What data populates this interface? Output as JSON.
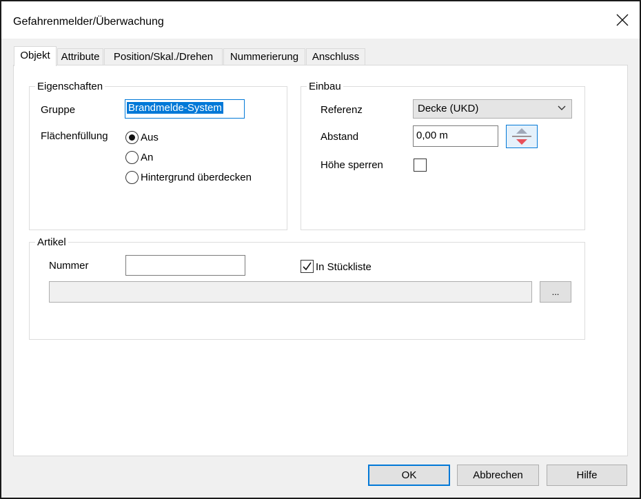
{
  "window": {
    "title": "Gefahrenmelder/Überwachung"
  },
  "icons": {
    "close": "close-icon",
    "height_toggle": "height-arrows-icon",
    "dropdown": "chevron-down-icon",
    "check": "checkmark-icon"
  },
  "tabs": [
    {
      "label": "Objekt",
      "active": true
    },
    {
      "label": "Attribute"
    },
    {
      "label": "Position/Skal./Drehen"
    },
    {
      "label": "Nummerierung"
    },
    {
      "label": "Anschluss"
    }
  ],
  "eigenschaften": {
    "legend": "Eigenschaften",
    "gruppe_label": "Gruppe",
    "gruppe_value": "Brandmelde-System",
    "flaechen_label": "Flächenfüllung",
    "options": [
      "Aus",
      "An",
      "Hintergrund überdecken"
    ],
    "selected": "Aus"
  },
  "einbau": {
    "legend": "Einbau",
    "referenz_label": "Referenz",
    "referenz_value": "Decke (UKD)",
    "abstand_label": "Abstand",
    "abstand_value": "0,00 m",
    "hoehe_label": "Höhe sperren",
    "hoehe_checked": false
  },
  "artikel": {
    "legend": "Artikel",
    "nummer_label": "Nummer",
    "nummer_value": "",
    "stueckliste_label": "In Stückliste",
    "stueckliste_checked": true,
    "browse_label": "..."
  },
  "buttons": {
    "ok": "OK",
    "cancel": "Abbrechen",
    "help": "Hilfe"
  },
  "colors": {
    "accent": "#0078d7",
    "arrow_down": "#e8505b",
    "arrow_up": "#a0a8b8"
  }
}
